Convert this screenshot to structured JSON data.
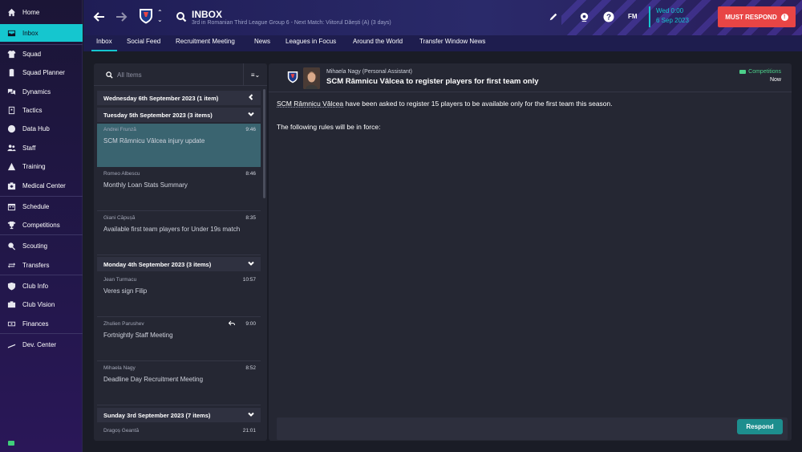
{
  "sidebar": {
    "items": [
      {
        "label": "Home",
        "icon": "home-icon"
      },
      {
        "label": "Inbox",
        "icon": "inbox-icon"
      },
      {
        "label": "Squad",
        "icon": "shirt-icon"
      },
      {
        "label": "Squad Planner",
        "icon": "clipboard-icon"
      },
      {
        "label": "Dynamics",
        "icon": "dynamics-icon"
      },
      {
        "label": "Tactics",
        "icon": "tactics-icon"
      },
      {
        "label": "Data Hub",
        "icon": "data-hub-icon"
      },
      {
        "label": "Staff",
        "icon": "staff-icon"
      },
      {
        "label": "Training",
        "icon": "training-icon"
      },
      {
        "label": "Medical Center",
        "icon": "medical-icon"
      },
      {
        "label": "Schedule",
        "icon": "calendar-icon"
      },
      {
        "label": "Competitions",
        "icon": "trophy-icon"
      },
      {
        "label": "Scouting",
        "icon": "scouting-icon"
      },
      {
        "label": "Transfers",
        "icon": "transfers-icon"
      },
      {
        "label": "Club Info",
        "icon": "shield-icon"
      },
      {
        "label": "Club Vision",
        "icon": "vision-icon"
      },
      {
        "label": "Finances",
        "icon": "finances-icon"
      },
      {
        "label": "Dev. Center",
        "icon": "dev-center-icon"
      }
    ],
    "active_color": "#15c6cf"
  },
  "header": {
    "title": "INBOX",
    "subtitle": "3rd in Romanian Third League Group 6 - Next Match: Viitorul Dăești (A) (3 days)",
    "fm_label": "FM",
    "date_line1": "Wed 0:00",
    "date_line2": "6 Sep 2023",
    "must_respond": "MUST RESPOND",
    "must_respond_color": "#e84545"
  },
  "tabs": [
    {
      "label": "Inbox",
      "active": true
    },
    {
      "label": "Social Feed"
    },
    {
      "label": "Recruitment Meeting"
    },
    {
      "label": "News"
    },
    {
      "label": "Leagues in Focus"
    },
    {
      "label": "Around the World"
    },
    {
      "label": "Transfer Window News"
    }
  ],
  "list": {
    "search_placeholder": "All Items",
    "groups": [
      {
        "label": "Wednesday 6th September 2023 (1 item)"
      },
      {
        "label": "Tuesday 5th September 2023 (3 items)"
      },
      {
        "label": "Monday 4th September 2023 (3 items)"
      },
      {
        "label": "Sunday 3rd September 2023 (7 items)"
      }
    ],
    "messages": [
      {
        "from": "Andrei Frunză",
        "time": "9:46",
        "subject": "SCM Râmnicu Vâlcea injury update"
      },
      {
        "from": "Romeo Albescu",
        "time": "8:46",
        "subject": "Monthly Loan Stats Summary"
      },
      {
        "from": "Giani Căpușă",
        "time": "8:35",
        "subject": "Available first team players for Under 19s match"
      },
      {
        "from": "Jean Turmacu",
        "time": "10:57",
        "subject": "Veres sign Filip"
      },
      {
        "from": "Zhulien Parushev",
        "time": "9:00",
        "subject": "Fortnightly Staff Meeting"
      },
      {
        "from": "Mihaela Nagy",
        "time": "8:52",
        "subject": "Deadline Day Recruitment Meeting"
      },
      {
        "from": "Dragoș Geantă",
        "time": "21:01",
        "subject": ""
      }
    ]
  },
  "message": {
    "sender": "Mihaela Nagy",
    "sender_role": "(Personal Assistant)",
    "title": "SCM Râmnicu Vâlcea to register players for first team only",
    "category": "Competitions",
    "when": "Now",
    "body_club": "SCM Râmnicu Vâlcea",
    "body_line1_rest": " have been asked to register 15 players to be available only for the first team this season.",
    "body_line2": "The following rules will be in force:",
    "respond": "Respond"
  }
}
